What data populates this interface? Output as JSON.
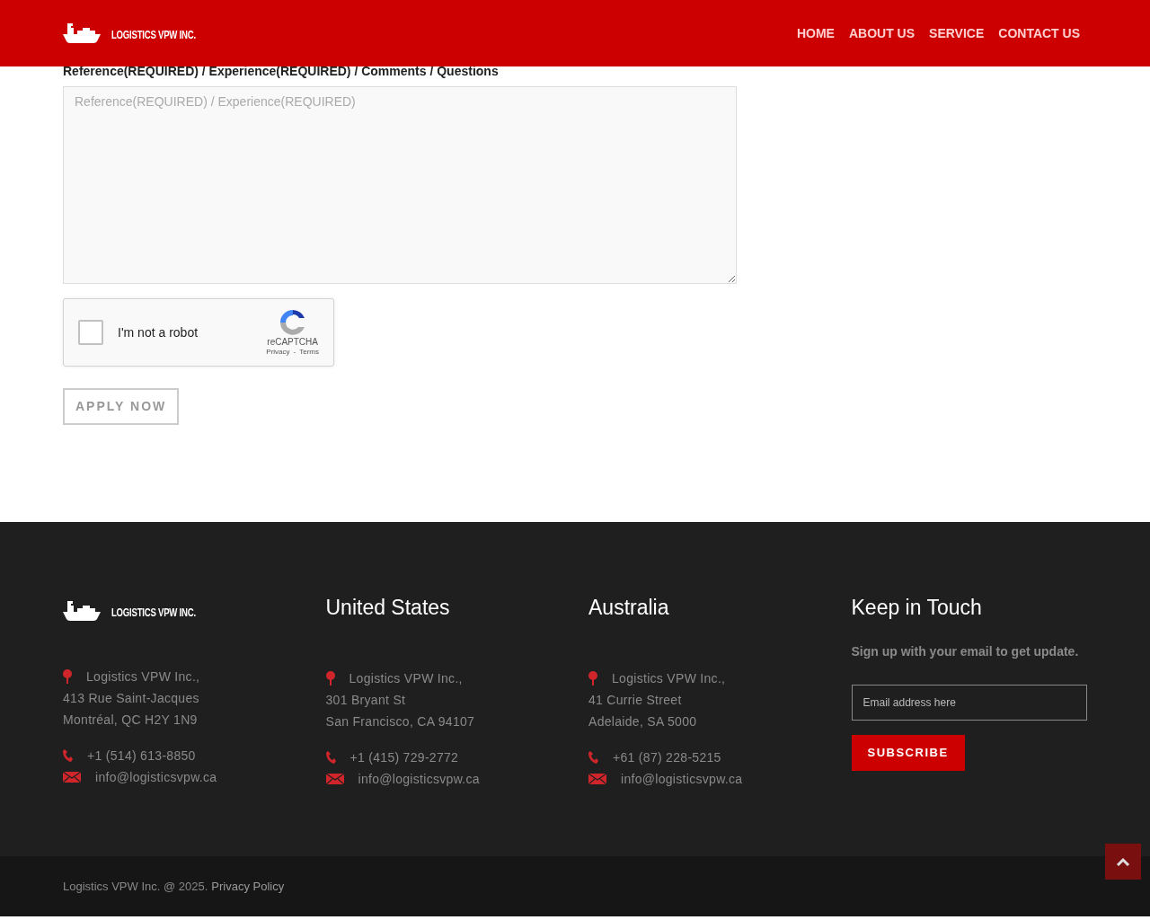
{
  "header": {
    "logo_text": "LOGISTICS VPW INC.",
    "nav": [
      "HOME",
      "ABOUT US",
      "SERVICE",
      "CONTACT US"
    ]
  },
  "form": {
    "label": "Reference(REQUIRED) / Experience(REQUIRED) / Comments / Questions",
    "placeholder": "Reference(REQUIRED) / Experience(REQUIRED)",
    "captcha": {
      "label": "I'm not a robot",
      "checked": false,
      "brand": "reCAPTCHA",
      "privacy": "Privacy",
      "separator": "-",
      "terms": "Terms"
    },
    "submit": "APPLY NOW"
  },
  "footer": {
    "logo_text": "LOGISTICS VPW INC.",
    "offices": [
      {
        "lines": [
          "Logistics VPW Inc.,",
          "413 Rue Saint-Jacques",
          "Montréal, QC H2Y 1N9"
        ],
        "phone": "+1 (514) 613-8850",
        "email": "info@logisticsvpw.ca"
      },
      {
        "title": "United States",
        "lines": [
          "Logistics VPW Inc.,",
          "301 Bryant St",
          "San Francisco, CA 94107"
        ],
        "phone": "+1 (415) 729-2772",
        "email": "info@logisticsvpw.ca"
      },
      {
        "title": "Australia",
        "lines": [
          "Logistics VPW Inc.,",
          "41 Currie Street",
          "Adelaide, SA 5000"
        ],
        "phone": "+61 (87) 228-5215",
        "email": "info@logisticsvpw.ca"
      }
    ],
    "newsletter": {
      "title": "Keep in Touch",
      "text": "Sign up with your email to get update.",
      "placeholder": "Email address here",
      "button": "SUBSCRIBE"
    },
    "copyright": "Logistics VPW Inc. @ 2025.",
    "policy_link": "Privacy Policy"
  }
}
